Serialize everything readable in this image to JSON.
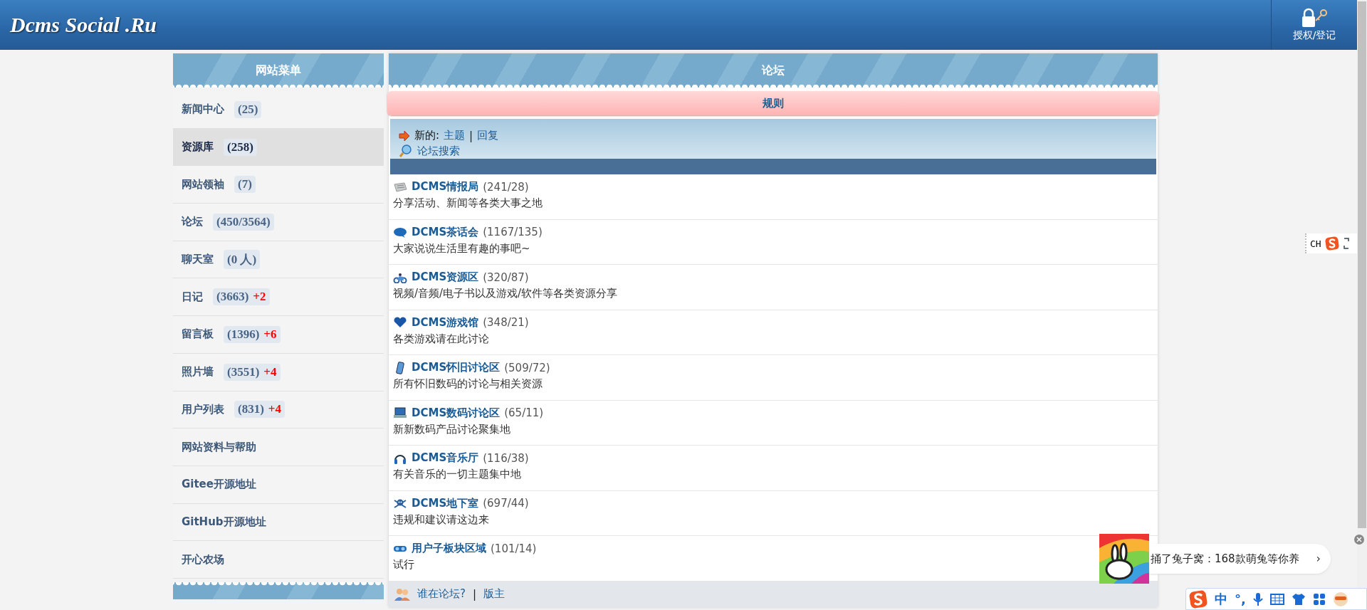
{
  "header": {
    "logo": "Dcms Social .Ru",
    "login": "授权/登记"
  },
  "sidebar": {
    "title": "网站菜单",
    "items": [
      {
        "label": "新闻中心",
        "count": "(25)",
        "selected": false
      },
      {
        "label": "资源库",
        "count": "(258)",
        "selected": true
      },
      {
        "label": "网站领袖",
        "count": "(7)",
        "selected": false
      },
      {
        "label": "论坛",
        "count": "(450/3564)",
        "selected": false
      },
      {
        "label": "聊天室",
        "count": "(0 人)",
        "selected": false
      },
      {
        "label": "日记",
        "count": "(3663)",
        "new": "+2",
        "selected": false
      },
      {
        "label": "留言板",
        "count": "(1396)",
        "new": "+6",
        "selected": false
      },
      {
        "label": "照片墙",
        "count": "(3551)",
        "new": "+4",
        "selected": false
      },
      {
        "label": "用户列表",
        "count": "(831)",
        "new": "+4",
        "selected": false
      },
      {
        "label": "网站资料与帮助",
        "selected": false
      },
      {
        "label": "Gitee开源地址",
        "selected": false
      },
      {
        "label": "GitHub开源地址",
        "selected": false
      },
      {
        "label": "开心农场",
        "selected": false
      }
    ]
  },
  "forum": {
    "title": "论坛",
    "rules": "规则",
    "news_label": "新的:",
    "news_links": [
      "主题",
      "回复"
    ],
    "news_separator": "|",
    "search": "论坛搜索",
    "boards": [
      {
        "name": "DCMS情报局",
        "count": "(241/28)",
        "desc": "分享活动、新闻等各类大事之地"
      },
      {
        "name": "DCMS茶话会",
        "count": "(1167/135)",
        "desc": "大家说说生活里有趣的事吧~"
      },
      {
        "name": "DCMS资源区",
        "count": "(320/87)",
        "desc": "视频/音频/电子书以及游戏/软件等各类资源分享"
      },
      {
        "name": "DCMS游戏馆",
        "count": "(348/21)",
        "desc": "各类游戏请在此讨论"
      },
      {
        "name": "DCMS怀旧讨论区",
        "count": "(509/72)",
        "desc": "所有怀旧数码的讨论与相关资源"
      },
      {
        "name": "DCMS数码讨论区",
        "count": "(65/11)",
        "desc": "新新数码产品讨论聚集地"
      },
      {
        "name": "DCMS音乐厅",
        "count": "(116/38)",
        "desc": "有关音乐的一切主题集中地"
      },
      {
        "name": "DCMS地下室",
        "count": "(697/44)",
        "desc": "违规和建议请这边来"
      },
      {
        "name": "用户子板块区域",
        "count": "(101/14)",
        "desc": "试行"
      }
    ],
    "footer": {
      "who": "谁在论坛?",
      "separator": "|",
      "moderators": "版主"
    }
  },
  "ad": {
    "text": "捅了兔子窝：168款萌兔等你养",
    "arrow": "›"
  },
  "ime": {
    "indicator": "CH",
    "mode": "中",
    "punct": "°,"
  }
}
